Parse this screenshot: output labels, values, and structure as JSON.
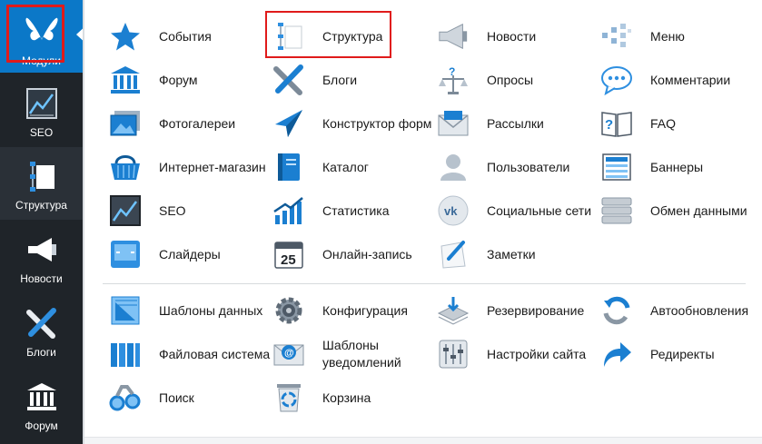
{
  "sidebar": {
    "items": [
      {
        "label": "Модули",
        "icon": "butterfly-icon"
      },
      {
        "label": "SEO",
        "icon": "seo-chart-icon"
      },
      {
        "label": "Структура",
        "icon": "structure-icon"
      },
      {
        "label": "Новости",
        "icon": "megaphone-icon"
      },
      {
        "label": "Блоги",
        "icon": "pen-pencil-icon"
      },
      {
        "label": "Форум",
        "icon": "forum-building-icon"
      }
    ]
  },
  "modules": {
    "main": [
      {
        "label": "События",
        "icon": "star-icon"
      },
      {
        "label": "Структура",
        "icon": "structure-icon"
      },
      {
        "label": "Новости",
        "icon": "megaphone-icon"
      },
      {
        "label": "Меню",
        "icon": "menu-tree-icon"
      },
      {
        "label": "Форум",
        "icon": "forum-building-icon"
      },
      {
        "label": "Блоги",
        "icon": "pen-pencil-icon"
      },
      {
        "label": "Опросы",
        "icon": "poll-scales-icon"
      },
      {
        "label": "Комментарии",
        "icon": "comment-bubble-icon"
      },
      {
        "label": "Фотогалереи",
        "icon": "photo-gallery-icon"
      },
      {
        "label": "Конструктор форм",
        "icon": "paper-plane-icon"
      },
      {
        "label": "Рассылки",
        "icon": "mail-icon"
      },
      {
        "label": "FAQ",
        "icon": "faq-book-icon"
      },
      {
        "label": "Интернет-магазин",
        "icon": "shopping-basket-icon"
      },
      {
        "label": "Каталог",
        "icon": "catalog-book-icon"
      },
      {
        "label": "Пользователи",
        "icon": "user-icon"
      },
      {
        "label": "Баннеры",
        "icon": "banner-icon"
      },
      {
        "label": "SEO",
        "icon": "seo-chart-icon"
      },
      {
        "label": "Статистика",
        "icon": "statistics-icon"
      },
      {
        "label": "Социальные сети",
        "icon": "vk-icon"
      },
      {
        "label": "Обмен данными",
        "icon": "server-icon"
      },
      {
        "label": "Слайдеры",
        "icon": "slider-icon"
      },
      {
        "label": "Онлайн-запись",
        "icon": "calendar-icon"
      },
      {
        "label": "Заметки",
        "icon": "notes-icon"
      }
    ],
    "system": [
      {
        "label": "Шаблоны данных",
        "icon": "data-templates-icon"
      },
      {
        "label": "Конфигурация",
        "icon": "gear-icon"
      },
      {
        "label": "Резервирование",
        "icon": "backup-icon"
      },
      {
        "label": "Автообновления",
        "icon": "refresh-icon"
      },
      {
        "label": "Файловая система",
        "icon": "folders-icon"
      },
      {
        "label": "Шаблоны уведомлений",
        "icon": "notification-templates-icon"
      },
      {
        "label": "Настройки сайта",
        "icon": "sliders-icon"
      },
      {
        "label": "Редиректы",
        "icon": "redirect-arrow-icon"
      },
      {
        "label": "Поиск",
        "icon": "binoculars-icon"
      },
      {
        "label": "Корзина",
        "icon": "recycle-bin-icon"
      }
    ]
  },
  "colors": {
    "sidebar_bg": "#1f2429",
    "active_bg": "#0b78c8",
    "accent_blue": "#1b7fd1",
    "highlight_red": "#e01b1b"
  }
}
